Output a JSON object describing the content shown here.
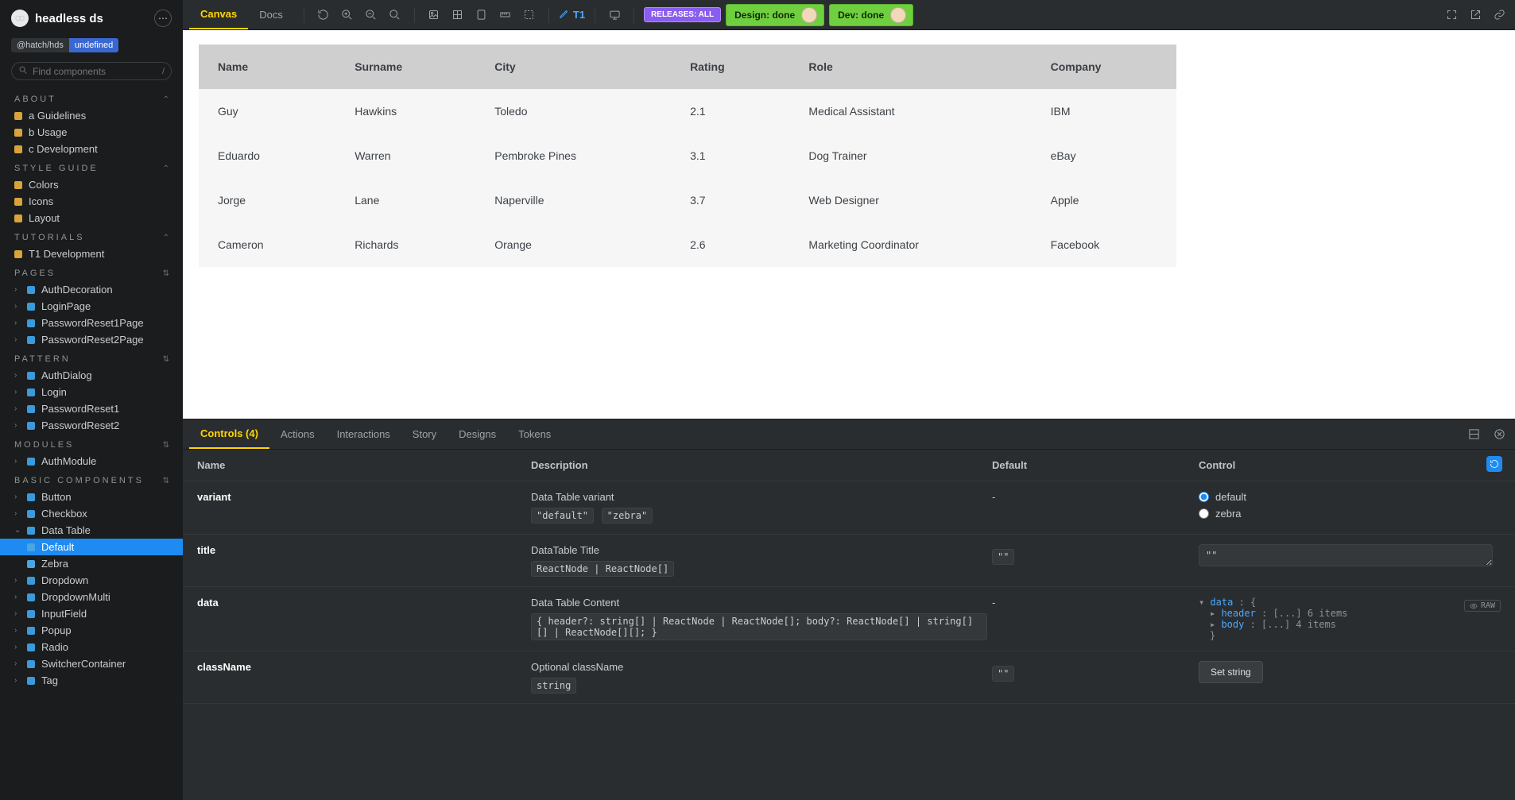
{
  "brand": {
    "name": "headless ds"
  },
  "scope": {
    "prefix": "@hatch/hds",
    "suffix": "undefined"
  },
  "search": {
    "placeholder": "Find components",
    "shortcut": "/"
  },
  "topbar": {
    "tabs": {
      "canvas": "Canvas",
      "docs": "Docs"
    },
    "pen_label": "T1",
    "releases": "RELEASES: ALL",
    "design_status": "Design: done",
    "dev_status": "Dev: done"
  },
  "sidebar": {
    "sections": {
      "about": {
        "title": "ABOUT",
        "items": [
          "a Guidelines",
          "b Usage",
          "c Development"
        ]
      },
      "style_guide": {
        "title": "STYLE GUIDE",
        "items": [
          "Colors",
          "Icons",
          "Layout"
        ]
      },
      "tutorials": {
        "title": "TUTORIALS",
        "items": [
          "T1 Development"
        ]
      },
      "pages": {
        "title": "PAGES",
        "items": [
          "AuthDecoration",
          "LoginPage",
          "PasswordReset1Page",
          "PasswordReset2Page"
        ]
      },
      "pattern": {
        "title": "PATTERN",
        "items": [
          "AuthDialog",
          "Login",
          "PasswordReset1",
          "PasswordReset2"
        ]
      },
      "modules": {
        "title": "MODULES",
        "items": [
          "AuthModule"
        ]
      },
      "basic": {
        "title": "BASIC COMPONENTS",
        "items": [
          "Button",
          "Checkbox",
          "Data Table",
          "Dropdown",
          "DropdownMulti",
          "InputField",
          "Popup",
          "Radio",
          "SwitcherContainer",
          "Tag"
        ],
        "data_table_children": [
          "Default",
          "Zebra"
        ],
        "selected_child": "Default"
      }
    }
  },
  "preview": {
    "columns": [
      "Name",
      "Surname",
      "City",
      "Rating",
      "Role",
      "Company"
    ],
    "rows": [
      {
        "name": "Guy",
        "surname": "Hawkins",
        "city": "Toledo",
        "rating": "2.1",
        "role": "Medical Assistant",
        "company": "IBM"
      },
      {
        "name": "Eduardo",
        "surname": "Warren",
        "city": "Pembroke Pines",
        "rating": "3.1",
        "role": "Dog Trainer",
        "company": "eBay"
      },
      {
        "name": "Jorge",
        "surname": "Lane",
        "city": "Naperville",
        "rating": "3.7",
        "role": "Web Designer",
        "company": "Apple"
      },
      {
        "name": "Cameron",
        "surname": "Richards",
        "city": "Orange",
        "rating": "2.6",
        "role": "Marketing Coordinator",
        "company": "Facebook"
      }
    ]
  },
  "addons": {
    "tabs": [
      "Controls (4)",
      "Actions",
      "Interactions",
      "Story",
      "Designs",
      "Tokens"
    ],
    "head": {
      "name": "Name",
      "description": "Description",
      "default": "Default",
      "control": "Control"
    },
    "raw_label": "RAW",
    "args": {
      "variant": {
        "name": "variant",
        "description": "Data Table variant",
        "type_tokens": [
          "\"default\"",
          "\"zebra\""
        ],
        "default": "-",
        "options": [
          "default",
          "zebra"
        ],
        "selected": "default"
      },
      "title": {
        "name": "title",
        "description": "DataTable Title",
        "type_tokens": [
          "ReactNode | ReactNode[]"
        ],
        "default": "\"\"",
        "value": "\"\""
      },
      "data": {
        "name": "data",
        "description": "Data Table Content",
        "type_tokens": [
          "{ header?: string[] | ReactNode | ReactNode[]; body?: ReactNode[] | string[][] | ReactNode[][]; }"
        ],
        "default": "-",
        "tree": {
          "root_key": "data",
          "header_key": "header",
          "header_summary": "[...] 6 items",
          "body_key": "body",
          "body_summary": "[...] 4 items"
        }
      },
      "className": {
        "name": "className",
        "description": "Optional className",
        "type_tokens": [
          "string"
        ],
        "default": "\"\"",
        "button": "Set string"
      }
    }
  }
}
